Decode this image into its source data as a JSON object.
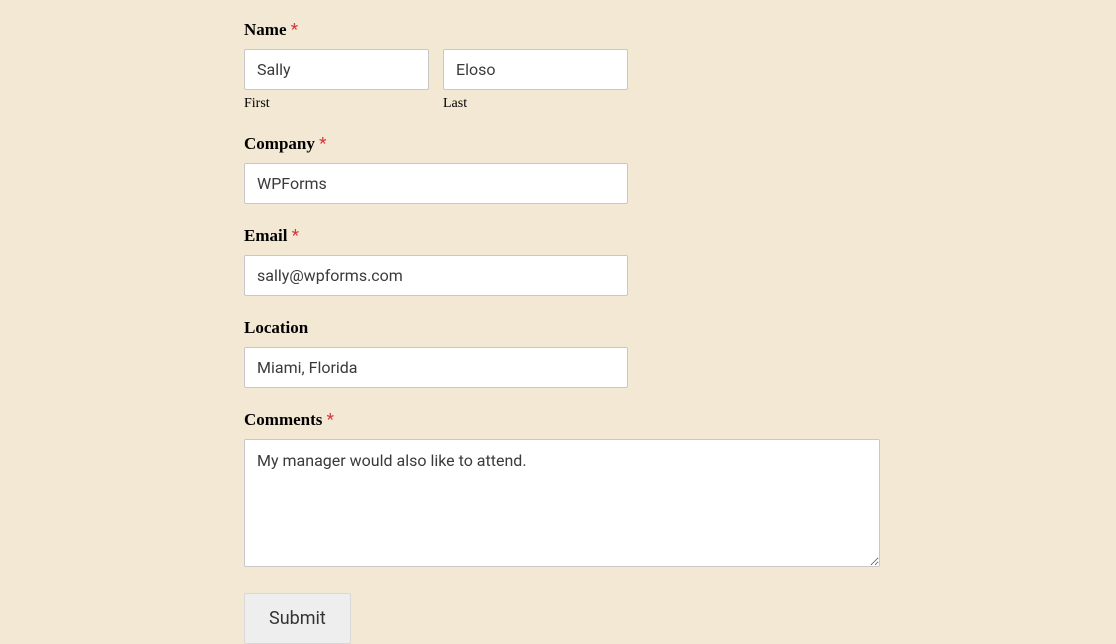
{
  "form": {
    "name": {
      "label": "Name",
      "required": "*",
      "first": {
        "value": "Sally",
        "sublabel": "First"
      },
      "last": {
        "value": "Eloso",
        "sublabel": "Last"
      }
    },
    "company": {
      "label": "Company",
      "required": "*",
      "value": "WPForms"
    },
    "email": {
      "label": "Email",
      "required": "*",
      "value": "sally@wpforms.com"
    },
    "location": {
      "label": "Location",
      "value": "Miami, Florida"
    },
    "comments": {
      "label": "Comments",
      "required": "*",
      "value": "My manager would also like to attend."
    },
    "submit": {
      "label": "Submit"
    }
  }
}
